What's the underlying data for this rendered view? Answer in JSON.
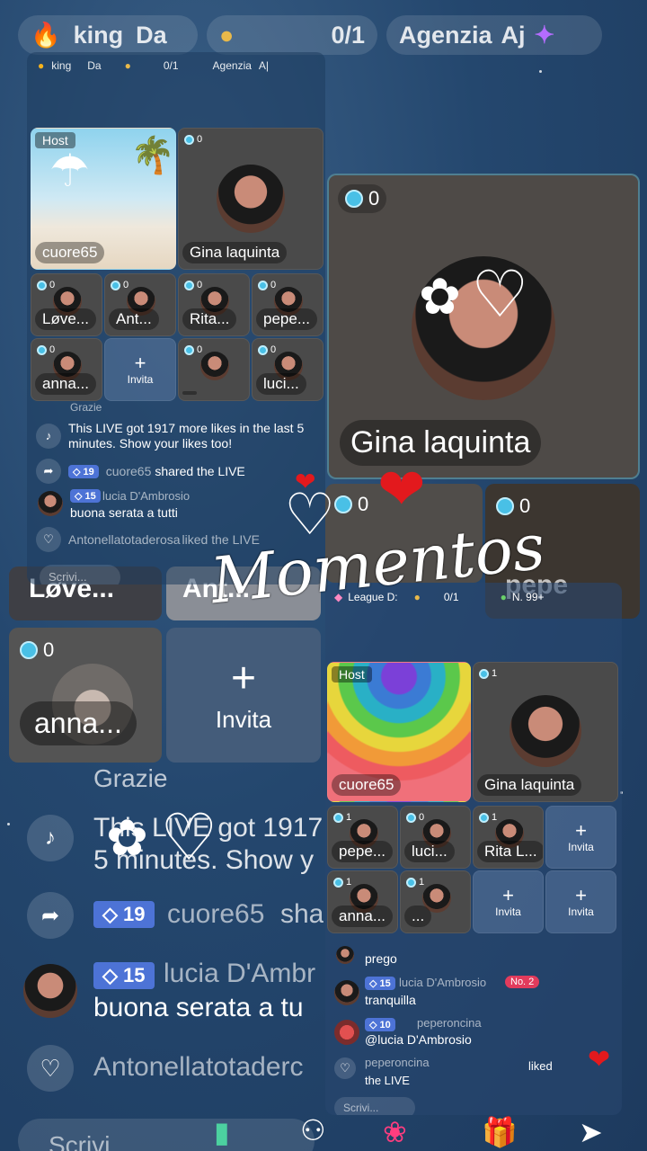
{
  "top_bar": {
    "ranking_label": "king",
    "ranking2_label": "Da",
    "guest_count": "0/1",
    "agency_label": "Agenzia",
    "agency_suffix": "Aj"
  },
  "mini_top_bar": {
    "ranking_label": "king",
    "ranking2_label": "Da",
    "guest_count": "0/1",
    "agency_label": "Agenzia",
    "agency_suffix": "A|"
  },
  "left_panel": {
    "host_label": "Host",
    "host_name": "cuore65",
    "guest_name": "Gina laquinta",
    "guest_count": "0",
    "seats": [
      {
        "name": "Løve...",
        "count": "0"
      },
      {
        "name": "Ant...",
        "count": "0"
      },
      {
        "name": "Rita...",
        "count": "0"
      },
      {
        "name": "pepe...",
        "count": "0"
      },
      {
        "name": "anna...",
        "count": "0"
      },
      {
        "name": "Invita",
        "count": ""
      },
      {
        "name": "",
        "count": "0"
      },
      {
        "name": "luci...",
        "count": "0"
      }
    ],
    "chat": {
      "partial": "Grazie",
      "likes_msg": "This LIVE got 1917 more likes in the last 5 minutes. Show your likes too!",
      "share_level": "19",
      "share_user": "cuore65",
      "share_msg": "shared the LIVE",
      "comment_level": "15",
      "comment_user": "lucia D'Ambrosio",
      "comment_msg": "buona serata a tutti",
      "like_user": "Antonellatotaderosa",
      "like_msg": "liked the LIVE"
    },
    "input_placeholder": "Scrivi..."
  },
  "big_guest": {
    "count": "0",
    "name": "Gina laquinta"
  },
  "background_tiles": {
    "love": "Løve...",
    "ant": "Ant...",
    "anna_count": "0",
    "anna": "anna...",
    "invite": "Invita",
    "c1": "0",
    "c2": "0",
    "pepe": "pepe"
  },
  "background_chat": {
    "partial": "Grazie",
    "likes_a": "This LIVE got 1917",
    "likes_b": "5 minutes. Show y",
    "share_level": "19",
    "share_user": "cuore65",
    "share_msg": "sha",
    "comment_level": "15",
    "comment_user": "lucia D'Ambr",
    "comment_msg": "buona serata a tu",
    "like_user": "Antonellatotaderc",
    "input_placeholder": "Scrivi"
  },
  "right_panel": {
    "league": "League D:",
    "guest_count": "0/1",
    "rank": "N. 99+",
    "host_label": "Host",
    "host_name": "cuore65",
    "guest_name": "Gina laquinta",
    "guest_count_badge": "1",
    "seats": [
      {
        "name": "pepe...",
        "count": "1"
      },
      {
        "name": "luci...",
        "count": "0"
      },
      {
        "name": "Rita L...",
        "count": "1"
      },
      {
        "name": "Invita",
        "count": ""
      },
      {
        "name": "anna...",
        "count": "1"
      },
      {
        "name": "...",
        "count": "1"
      },
      {
        "name": "Invita",
        "count": ""
      },
      {
        "name": "Invita",
        "count": ""
      }
    ],
    "chat": {
      "c1": "prego",
      "c2_level": "15",
      "c2_user": "lucia D'Ambrosio",
      "c2_rank": "No. 2",
      "c2_msg": "tranquilla",
      "c3_level": "10",
      "c3_user": "peperoncina",
      "c3_msg": "@lucia D'Ambrosio",
      "c4_user": "peperoncina",
      "c4_msg": "liked the LIVE"
    },
    "input_placeholder": "Scrivi..."
  },
  "overlay": {
    "title": "Momentos"
  },
  "colors": {
    "background": "#24476e",
    "heart": "#e3191d",
    "badge": "#4d73d6",
    "count_dot": "#49c0e6"
  }
}
